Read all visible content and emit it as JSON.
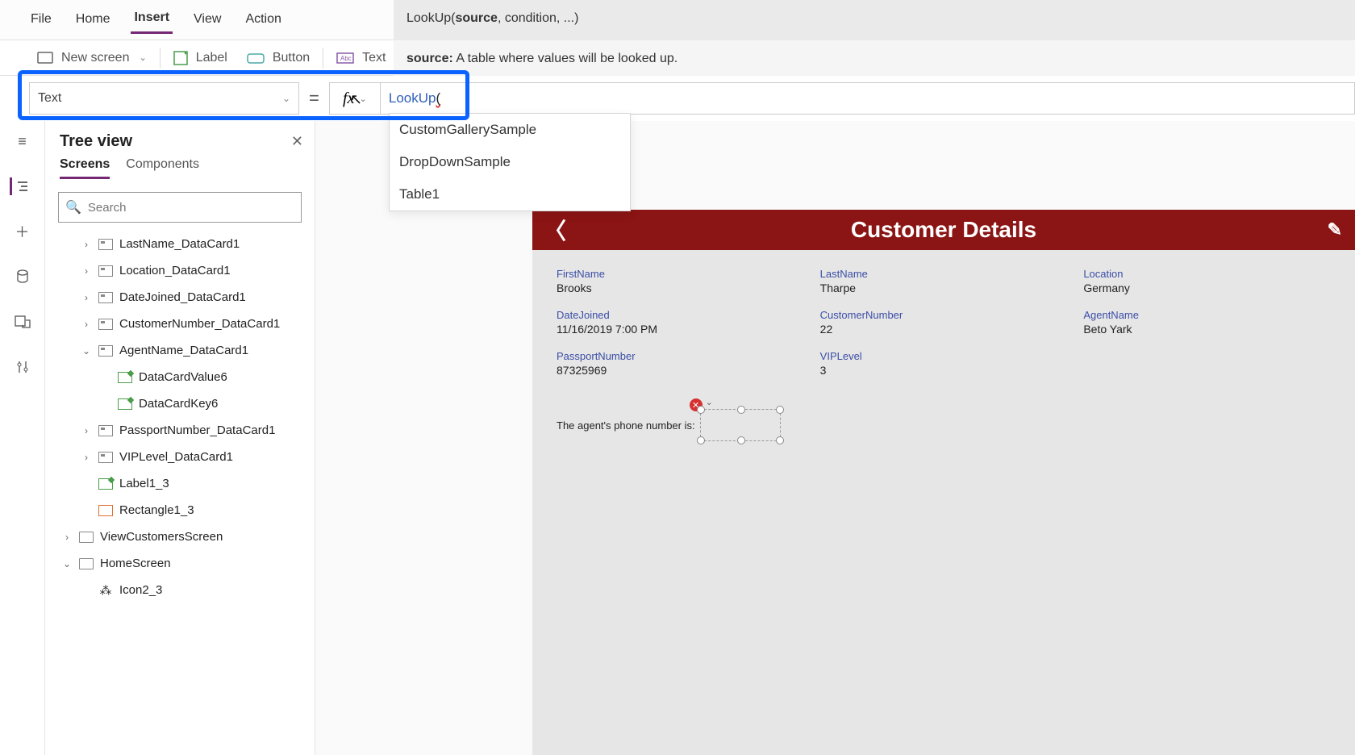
{
  "menubar": {
    "items": [
      "File",
      "Home",
      "Insert",
      "View",
      "Action"
    ],
    "active": "Insert"
  },
  "ribbon": {
    "newscreen": "New screen",
    "label": "Label",
    "button": "Button",
    "text": "Text"
  },
  "formula": {
    "property": "Text",
    "fx": "fx",
    "input_fn": "LookUp",
    "input_paren": "(",
    "hint_sig_pre": "LookUp(",
    "hint_sig_bold": "source",
    "hint_sig_post": ", condition, ...)",
    "hint_desc_bold": "source:",
    "hint_desc_rest": " A table where values will be looked up.",
    "autocomplete": [
      "CustomGallerySample",
      "DropDownSample",
      "Table1"
    ]
  },
  "tree": {
    "title": "Tree view",
    "tabs": [
      "Screens",
      "Components"
    ],
    "active_tab": "Screens",
    "search_placeholder": "Search",
    "items": [
      {
        "indent": 1,
        "exp": "right",
        "icon": "card",
        "label": "LastName_DataCard1"
      },
      {
        "indent": 1,
        "exp": "right",
        "icon": "card",
        "label": "Location_DataCard1"
      },
      {
        "indent": 1,
        "exp": "right",
        "icon": "card",
        "label": "DateJoined_DataCard1"
      },
      {
        "indent": 1,
        "exp": "right",
        "icon": "card",
        "label": "CustomerNumber_DataCard1"
      },
      {
        "indent": 1,
        "exp": "down",
        "icon": "card",
        "label": "AgentName_DataCard1"
      },
      {
        "indent": 2,
        "exp": "",
        "icon": "pencil",
        "label": "DataCardValue6"
      },
      {
        "indent": 2,
        "exp": "",
        "icon": "pencil",
        "label": "DataCardKey6"
      },
      {
        "indent": 1,
        "exp": "right",
        "icon": "card",
        "label": "PassportNumber_DataCard1"
      },
      {
        "indent": 1,
        "exp": "right",
        "icon": "card",
        "label": "VIPLevel_DataCard1"
      },
      {
        "indent": 1,
        "exp": "",
        "icon": "pencil",
        "label": "Label1_3"
      },
      {
        "indent": 1,
        "exp": "",
        "icon": "rect",
        "label": "Rectangle1_3"
      },
      {
        "indent": 0,
        "exp": "right",
        "icon": "screen",
        "label": "ViewCustomersScreen"
      },
      {
        "indent": 0,
        "exp": "down",
        "icon": "screen",
        "label": "HomeScreen"
      },
      {
        "indent": 1,
        "exp": "",
        "icon": "group",
        "label": "Icon2_3"
      }
    ]
  },
  "details": {
    "title": "Customer Details",
    "fields": [
      {
        "label": "FirstName",
        "value": "Brooks"
      },
      {
        "label": "LastName",
        "value": "Tharpe"
      },
      {
        "label": "Location",
        "value": "Germany"
      },
      {
        "label": "DateJoined",
        "value": "11/16/2019 7:00 PM"
      },
      {
        "label": "CustomerNumber",
        "value": "22"
      },
      {
        "label": "AgentName",
        "value": "Beto Yark"
      },
      {
        "label": "PassportNumber",
        "value": "87325969"
      },
      {
        "label": "VIPLevel",
        "value": "3"
      }
    ],
    "agent_label": "The agent's phone number is:"
  }
}
